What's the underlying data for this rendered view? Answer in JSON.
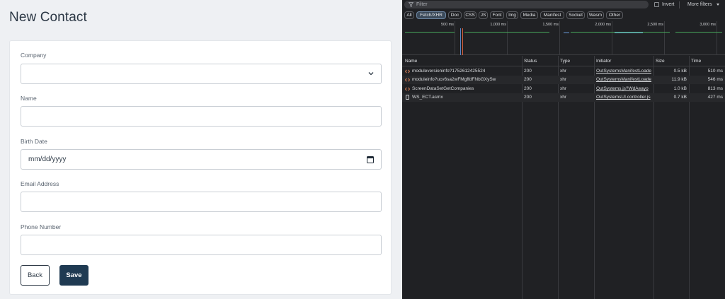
{
  "form": {
    "title": "New Contact",
    "fields": [
      {
        "label": "Company",
        "value": "",
        "type": "select"
      },
      {
        "label": "Name",
        "value": "",
        "type": "text"
      },
      {
        "label": "Birth Date",
        "value": "mm/dd/yyyy",
        "type": "date"
      },
      {
        "label": "Email Address",
        "value": "",
        "type": "text"
      },
      {
        "label": "Phone Number",
        "value": "",
        "type": "text"
      }
    ],
    "back_label": "Back",
    "save_label": "Save"
  },
  "devtools": {
    "filter_placeholder": "Filter",
    "invert_label": "Invert",
    "more_filters_label": "More filters",
    "type_filters": [
      "All",
      "Fetch/XHR",
      "Doc",
      "CSS",
      "JS",
      "Font",
      "Img",
      "Media",
      "Manifest",
      "Socket",
      "Wasm",
      "Other"
    ],
    "active_type_filter": "Fetch/XHR",
    "timeline_ticks": [
      "500 ms",
      "1,000 ms",
      "1,500 ms",
      "2,000 ms",
      "2,500 ms",
      "3,000 ms"
    ],
    "columns": [
      "Name",
      "Status",
      "Type",
      "Initiator",
      "Size",
      "Time"
    ],
    "requests": [
      {
        "icon": "xhr-icon",
        "name": "moduleversioninfo?1752612425524",
        "status": "200",
        "type": "xhr",
        "initiator": "OutSystemsManifestLoade",
        "size": "0.5 kB",
        "time": "510 ms"
      },
      {
        "icon": "xhr-icon",
        "name": "moduleinfo?ucv6sa2wFMgffdFNbGXySw",
        "status": "200",
        "type": "xhr",
        "initiator": "OutSystemsManifestLoade",
        "size": "11.9 kB",
        "time": "546 ms"
      },
      {
        "icon": "xhr-icon",
        "name": "ScreenDataSetGetCompanies",
        "status": "200",
        "type": "xhr",
        "initiator": "OutSystems.js?WdAeayo",
        "size": "1.0 kB",
        "time": "813 ms"
      },
      {
        "icon": "document-icon",
        "name": "WS_ECT.asmx",
        "status": "200",
        "type": "xhr",
        "initiator": "OutSystemsUI.controller.js",
        "size": "0.7 kB",
        "time": "427 ms"
      }
    ],
    "colors": {
      "accent_red": "#d9603f",
      "accent_blue": "#5b87c7",
      "bar_green": "#47a85b"
    }
  }
}
